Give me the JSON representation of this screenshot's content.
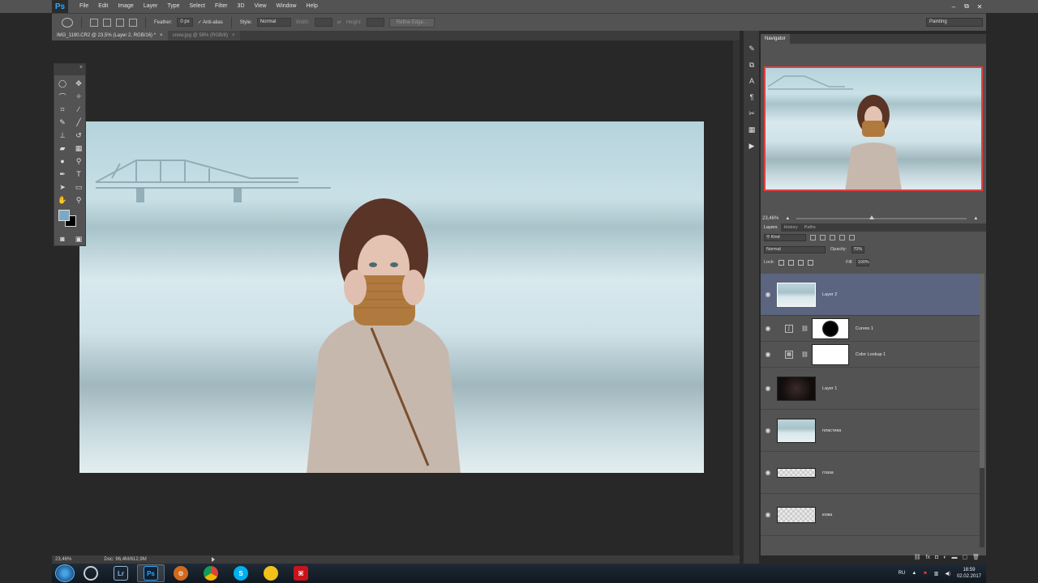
{
  "app": {
    "logo": "Ps",
    "menu": [
      "File",
      "Edit",
      "Image",
      "Layer",
      "Type",
      "Select",
      "Filter",
      "3D",
      "View",
      "Window",
      "Help"
    ],
    "window_controls": [
      "–",
      "⧉",
      "✕"
    ]
  },
  "options": {
    "feather_label": "Feather:",
    "feather_value": "0 px",
    "antialias_label": "Anti-alias",
    "style_label": "Style:",
    "style_value": "Normal",
    "width_label": "Width:",
    "height_label": "Height:",
    "refine_label": "Refine Edge...",
    "workspace": "Painting"
  },
  "doc_tabs": [
    {
      "label": "IMG_1190.CR2 @ 23,5% (Layer 2, RGB/16) *",
      "close": "×"
    },
    {
      "label": "snow.jpg @ 58% (RGB/8)",
      "close": "×"
    }
  ],
  "status": {
    "zoom": "23,46%",
    "doc": "Doc: 96,4M/612,9M"
  },
  "navigator": {
    "tab": "Navigator",
    "zoom": "23,46%"
  },
  "layers": {
    "tabs": [
      "Layers",
      "History",
      "Paths"
    ],
    "kind": "Kind",
    "blend_mode": "Normal",
    "opacity_label": "Opacity:",
    "opacity_value": "70%",
    "lock_label": "Lock:",
    "fill_label": "Fill:",
    "fill_value": "100%",
    "items": [
      {
        "name": "Layer 2"
      },
      {
        "name": "Curves 1"
      },
      {
        "name": "Color Lookup 1"
      },
      {
        "name": "Layer 1"
      },
      {
        "name": "пластика"
      },
      {
        "name": "глаза"
      },
      {
        "name": "кожа"
      },
      {
        "name": ""
      }
    ]
  },
  "taskbar": {
    "lang": "RU",
    "time": "18:59",
    "date": "02.02.2017",
    "apps": [
      "Lr",
      "Ps",
      "S"
    ]
  }
}
